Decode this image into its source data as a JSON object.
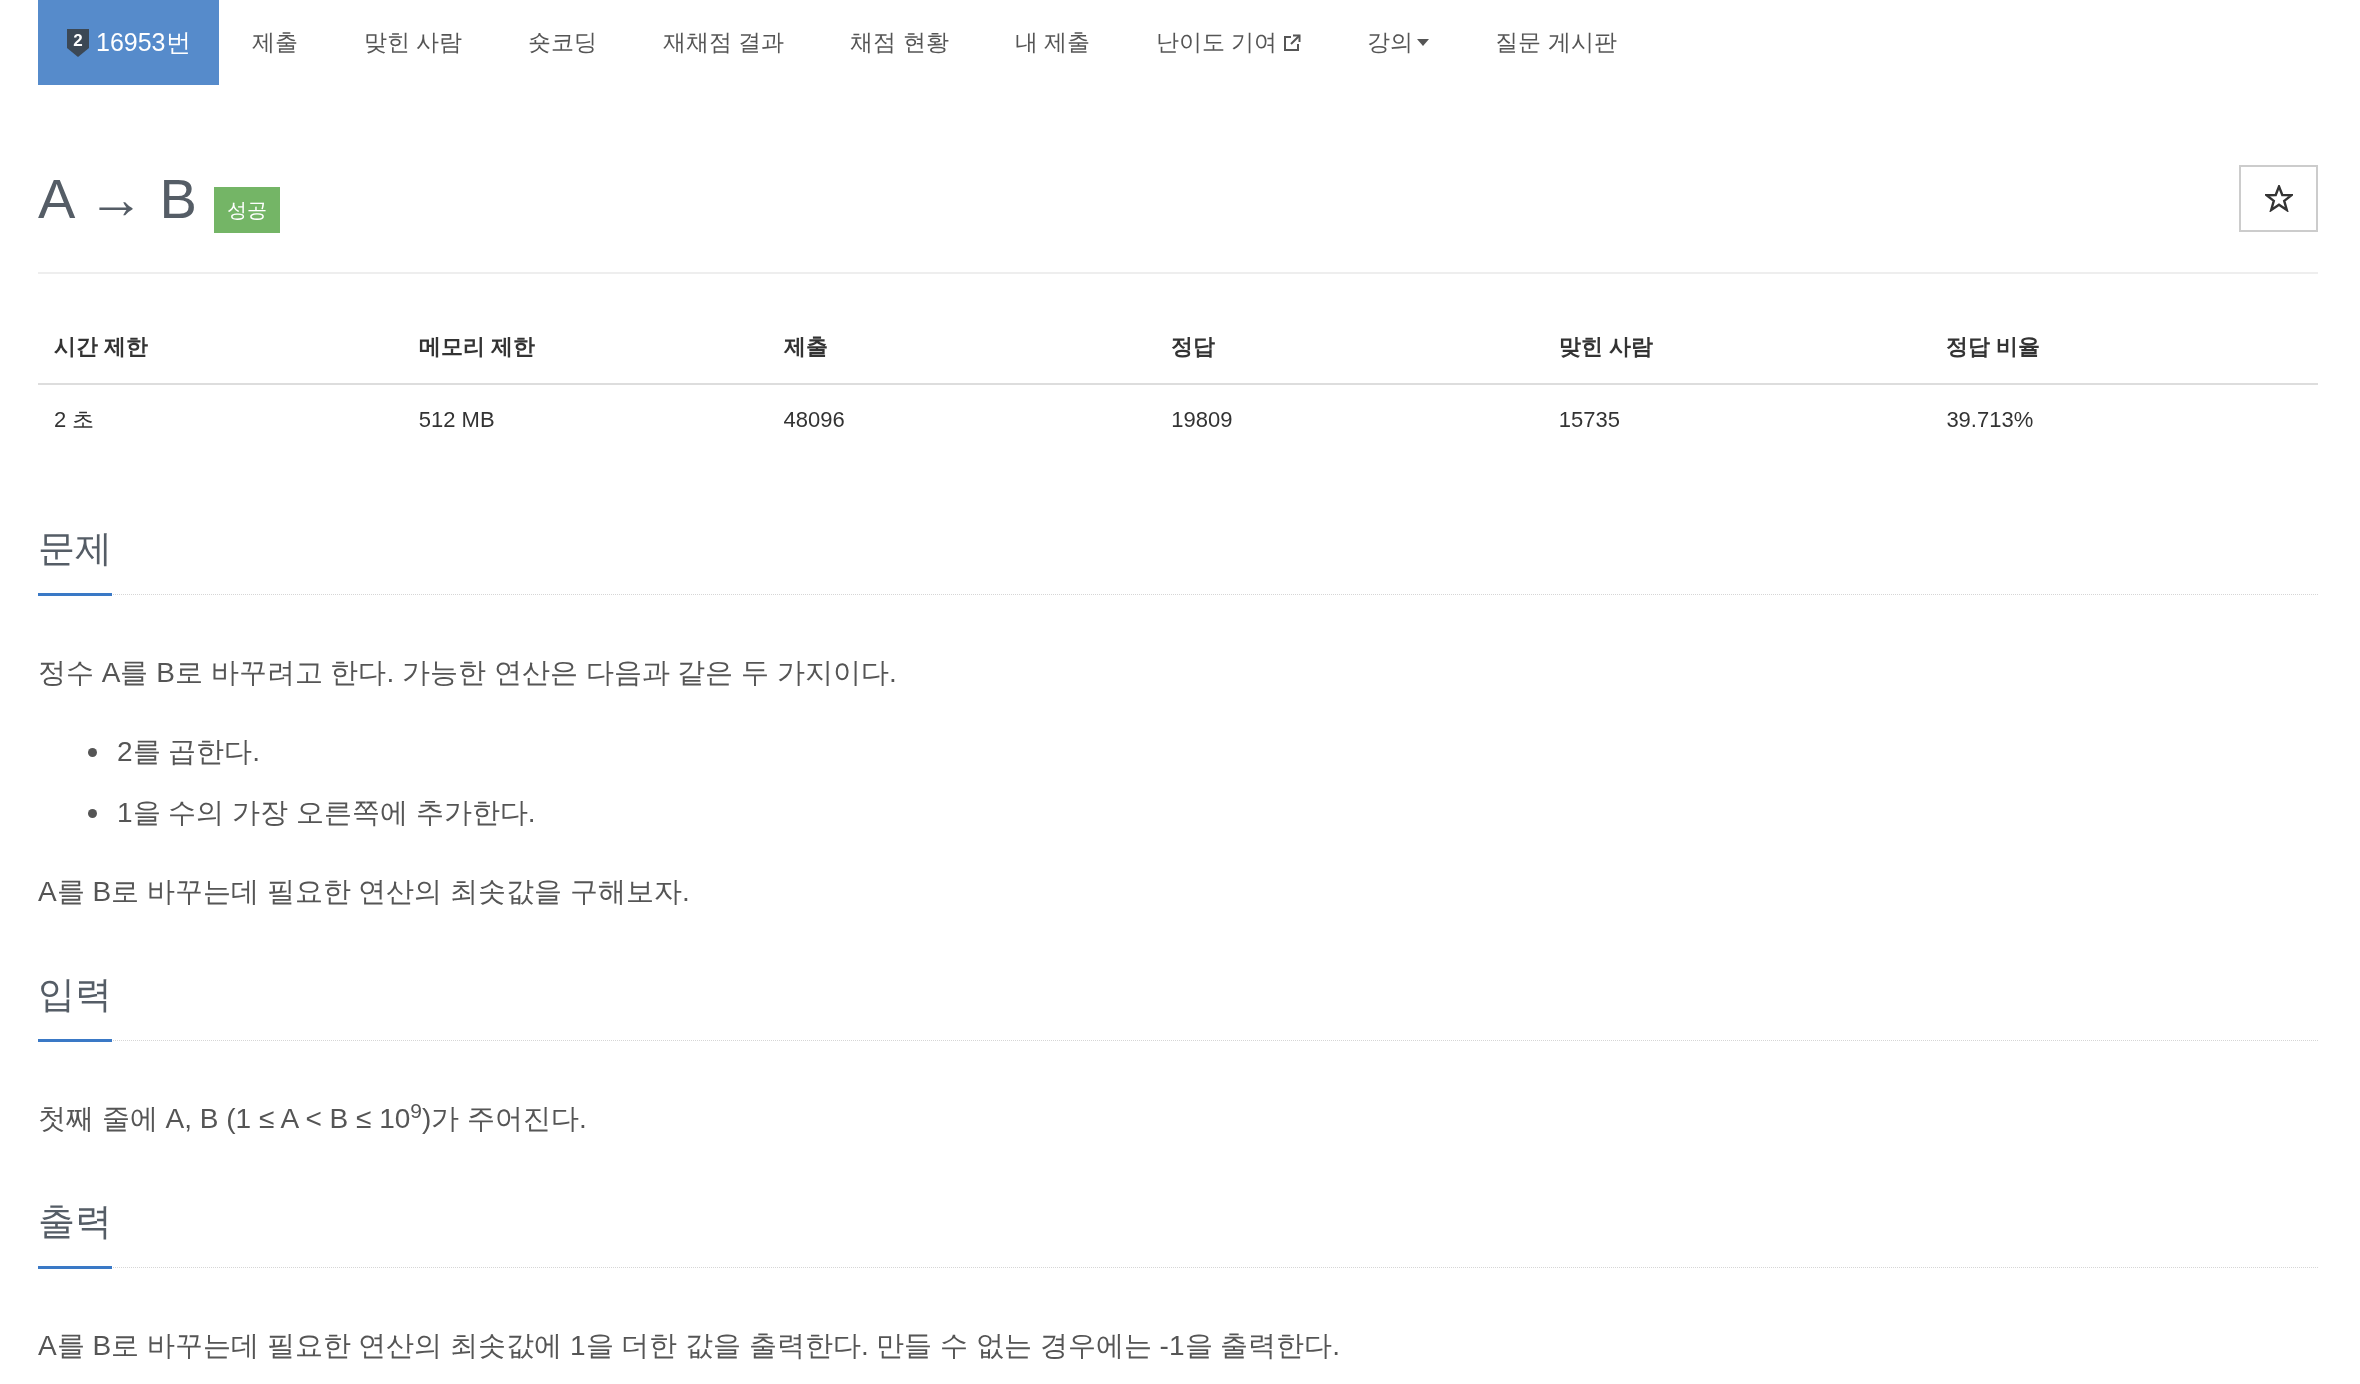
{
  "nav": {
    "tabs": [
      {
        "kind": "problem",
        "badge": "2",
        "label": "16953번",
        "selected": true
      },
      {
        "kind": "link",
        "label": "제출",
        "selected": false
      },
      {
        "kind": "link",
        "label": "맞힌 사람",
        "selected": false
      },
      {
        "kind": "link",
        "label": "숏코딩",
        "selected": false
      },
      {
        "kind": "link",
        "label": "재채점 결과",
        "selected": false
      },
      {
        "kind": "link",
        "label": "채점 현황",
        "selected": false
      },
      {
        "kind": "link",
        "label": "내 제출",
        "selected": false
      },
      {
        "kind": "external",
        "label": "난이도 기여",
        "selected": false
      },
      {
        "kind": "dropdown",
        "label": "강의",
        "selected": false
      },
      {
        "kind": "link",
        "label": "질문 게시판",
        "selected": false
      }
    ]
  },
  "problem": {
    "title": "A → B",
    "result_label": "성공",
    "starred": false
  },
  "stats": {
    "columns": [
      "시간 제한",
      "메모리 제한",
      "제출",
      "정답",
      "맞힌 사람",
      "정답 비율"
    ],
    "rows": [
      [
        "2 초",
        "512 MB",
        "48096",
        "19809",
        "15735",
        "39.713%"
      ]
    ]
  },
  "sections": [
    {
      "heading": "문제",
      "blocks": [
        {
          "kind": "paragraph",
          "text": "정수 A를 B로 바꾸려고 한다. 가능한 연산은 다음과 같은 두 가지이다."
        },
        {
          "kind": "list",
          "items": [
            "2를 곱한다.",
            "1을 수의 가장 오른쪽에 추가한다."
          ]
        },
        {
          "kind": "paragraph",
          "text": "A를 B로 바꾸는데 필요한 연산의 최솟값을 구해보자."
        }
      ]
    },
    {
      "heading": "입력",
      "blocks": [
        {
          "kind": "paragraph",
          "text": "첫째 줄에 A, B (1 ≤ A < B ≤ 10$^{9}$)가 주어진다."
        }
      ]
    },
    {
      "heading": "출력",
      "blocks": [
        {
          "kind": "paragraph",
          "text": "A를 B로 바꾸는데 필요한 연산의 최솟값에 1을 더한 값을 출력한다. 만들 수 없는 경우에는 -1을 출력한다."
        }
      ]
    }
  ]
}
